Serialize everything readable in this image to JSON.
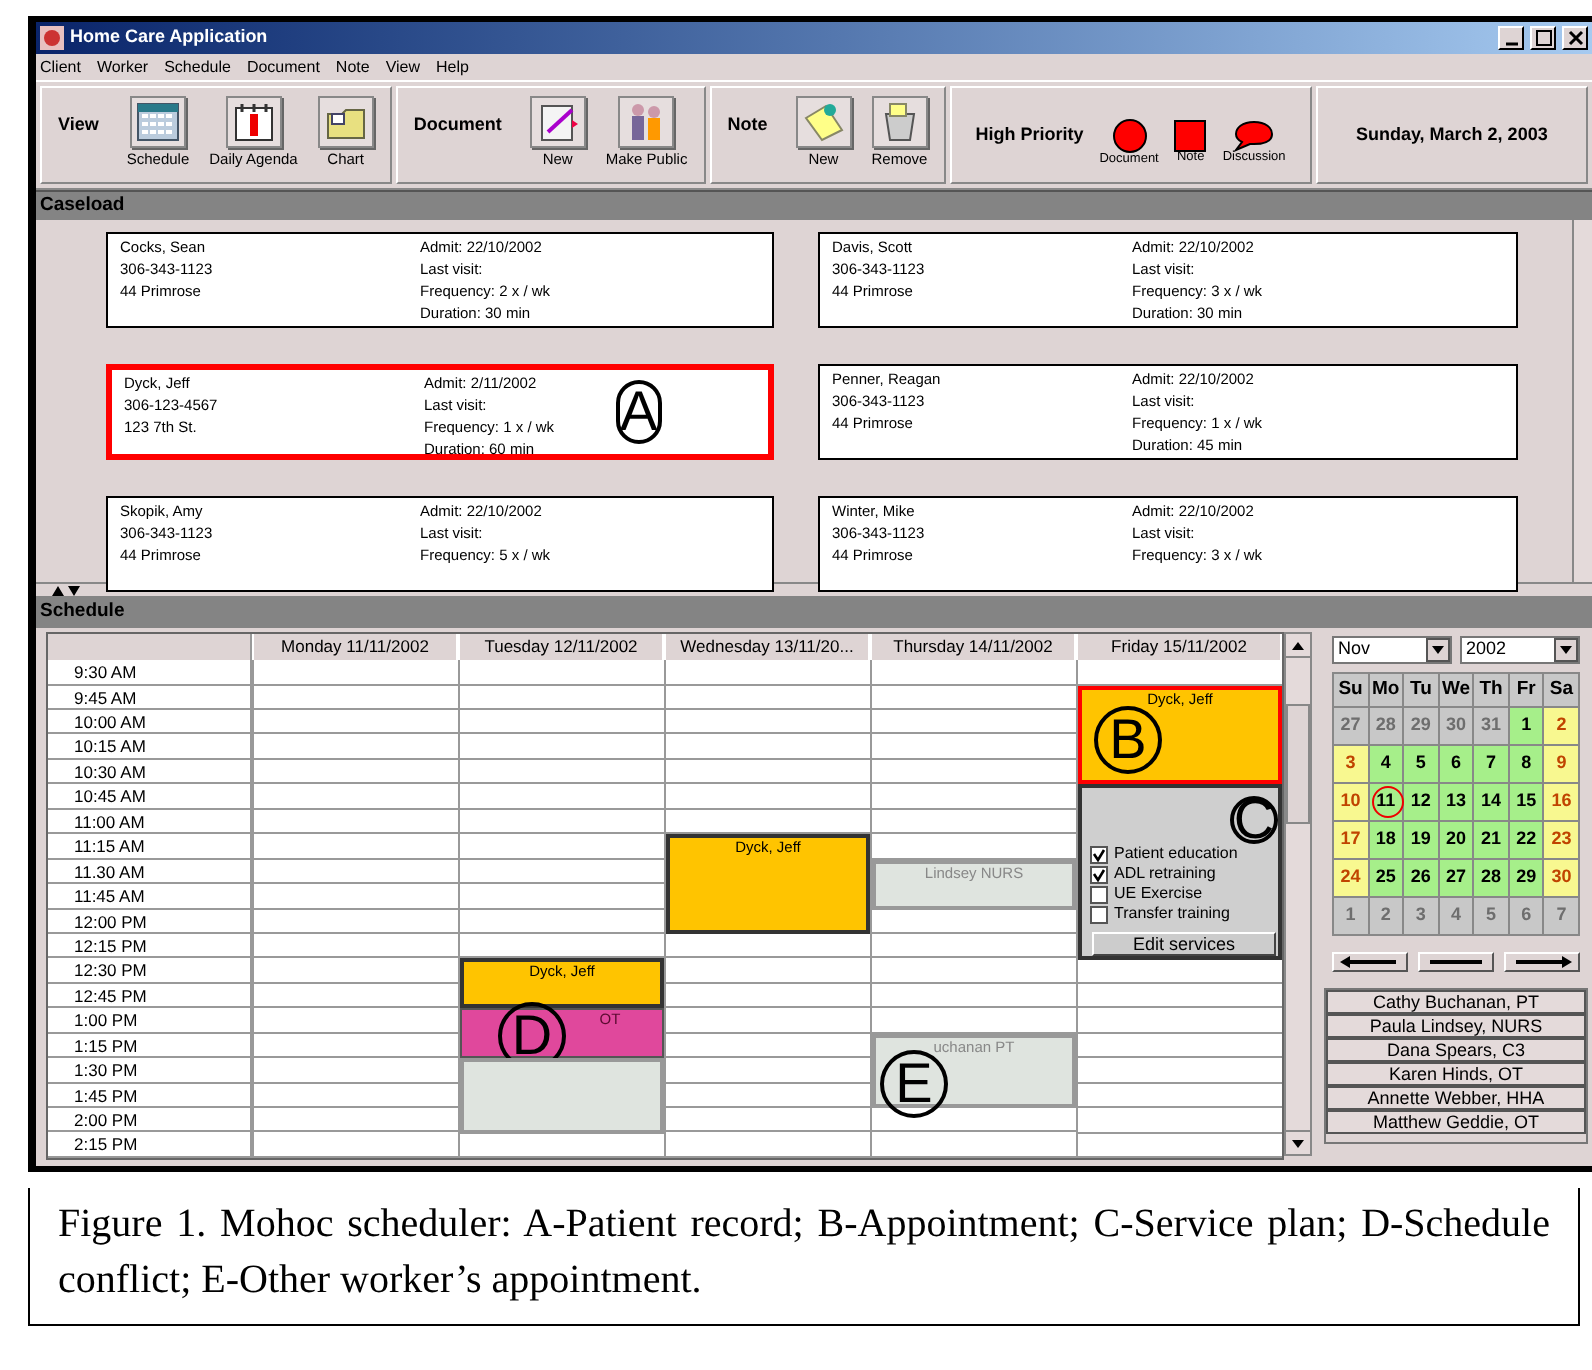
{
  "window": {
    "title": "Home Care Application"
  },
  "menu": [
    "Client",
    "Worker",
    "Schedule",
    "Document",
    "Note",
    "View",
    "Help"
  ],
  "toolbar": [
    {
      "kind": "buttons",
      "label": "View",
      "buttons": [
        {
          "label": "Schedule"
        },
        {
          "label": "Daily Agenda"
        },
        {
          "label": "Chart"
        }
      ]
    },
    {
      "kind": "buttons",
      "label": "Document",
      "buttons": [
        {
          "label": "New"
        },
        {
          "label": "Make Public"
        }
      ]
    },
    {
      "kind": "buttons",
      "label": "Note",
      "buttons": [
        {
          "label": "New"
        },
        {
          "label": "Remove"
        }
      ]
    },
    {
      "kind": "priority",
      "label": "High Priority",
      "items": [
        {
          "label": "Document"
        },
        {
          "label": "Note"
        },
        {
          "label": "Discussion"
        }
      ]
    },
    {
      "kind": "date",
      "label": "Sunday, March 2, 2003"
    }
  ],
  "caseload": {
    "title": "Caseload",
    "cards": [
      {
        "name": "Cocks, Sean",
        "phone": "306-343-1123",
        "address": "44 Primrose",
        "details": [
          "Admit: 22/10/2002",
          "Last visit:",
          "Frequency: 2 x / wk",
          "Duration: 30 min"
        ],
        "selected": false
      },
      {
        "name": "Davis, Scott",
        "phone": "306-343-1123",
        "address": "44 Primrose",
        "details": [
          "Admit: 22/10/2002",
          "Last visit:",
          "Frequency: 3 x / wk",
          "Duration: 30 min"
        ],
        "selected": false
      },
      {
        "name": "Dyck, Jeff",
        "phone": "306-123-4567",
        "address": "123 7th St.",
        "details": [
          "Admit: 2/11/2002",
          "Last visit:",
          "Frequency: 1 x / wk",
          "Duration: 60 min"
        ],
        "selected": true,
        "callout": "A"
      },
      {
        "name": "Penner, Reagan",
        "phone": "306-343-1123",
        "address": "44 Primrose",
        "details": [
          "Admit: 22/10/2002",
          "Last visit:",
          "Frequency: 1 x / wk",
          "Duration: 45 min"
        ],
        "selected": false
      },
      {
        "name": "Skopik, Amy",
        "phone": "306-343-1123",
        "address": "44 Primrose",
        "details": [
          "Admit: 22/10/2002",
          "Last visit:",
          "Frequency: 5 x / wk"
        ],
        "selected": false
      },
      {
        "name": "Winter, Mike",
        "phone": "306-343-1123",
        "address": "44 Primrose",
        "details": [
          "Admit: 22/10/2002",
          "Last visit:",
          "Frequency: 3 x / wk"
        ],
        "selected": false
      }
    ]
  },
  "schedule": {
    "title": "Schedule",
    "times": [
      "9:30 AM",
      "9:45 AM",
      "10:00 AM",
      "10:15 AM",
      "10:30 AM",
      "10:45 AM",
      "11:00 AM",
      "11:15 AM",
      "11.30 AM",
      "11:45 AM",
      "12:00 PM",
      "12:15 PM",
      "12:30 PM",
      "12:45 PM",
      "1:00 PM",
      "1:15 PM",
      "1:30 PM",
      "1:45 PM",
      "2:00 PM",
      "2:15 PM"
    ],
    "days": [
      {
        "label": "Monday 11/11/2002",
        "cells": [
          {
            "kind": "free"
          },
          {
            "kind": "free"
          },
          {
            "kind": "free"
          },
          {
            "kind": "free"
          },
          {
            "kind": "free"
          },
          {
            "kind": "free"
          },
          {
            "kind": "free"
          },
          {
            "kind": "free"
          },
          {
            "kind": "free"
          },
          {
            "kind": "free"
          },
          {
            "kind": "free"
          },
          {
            "kind": "free"
          },
          {
            "kind": "free"
          },
          {
            "kind": "free"
          },
          {
            "kind": "free"
          },
          {
            "kind": "free"
          },
          {
            "kind": "free"
          },
          {
            "kind": "free"
          },
          {
            "kind": "free"
          },
          {
            "kind": "free"
          }
        ]
      },
      {
        "label": "Tuesday 12/11/2002",
        "cells": [
          {
            "kind": "free"
          },
          {
            "kind": "free"
          },
          {
            "kind": "free"
          },
          {
            "kind": "free"
          },
          {
            "kind": "free"
          },
          {
            "kind": "free"
          },
          {
            "kind": "free"
          },
          {
            "kind": "free"
          },
          {
            "kind": "free"
          },
          {
            "kind": "free"
          },
          {
            "kind": "free"
          },
          {
            "kind": "free"
          },
          {
            "kind": "patient",
            "label": "Dyck, Jeff",
            "selected": false
          },
          {
            "kind": "patient"
          },
          {
            "kind": "conflict",
            "label": "OT",
            "callout": "D"
          },
          {
            "kind": "conflict"
          },
          {
            "kind": "other"
          },
          {
            "kind": "other"
          },
          {
            "kind": "other"
          },
          {
            "kind": "free"
          }
        ]
      },
      {
        "label": "Wednesday 13/11/20...",
        "cells": [
          {
            "kind": "free"
          },
          {
            "kind": "free"
          },
          {
            "kind": "free"
          },
          {
            "kind": "free"
          },
          {
            "kind": "free"
          },
          {
            "kind": "free"
          },
          {
            "kind": "free"
          },
          {
            "kind": "patient",
            "label": "Dyck, Jeff",
            "selected": false
          },
          {
            "kind": "patient"
          },
          {
            "kind": "patient"
          },
          {
            "kind": "patient"
          },
          {
            "kind": "free"
          },
          {
            "kind": "free"
          },
          {
            "kind": "free"
          },
          {
            "kind": "free"
          },
          {
            "kind": "free"
          },
          {
            "kind": "free"
          },
          {
            "kind": "free"
          },
          {
            "kind": "free"
          },
          {
            "kind": "free"
          }
        ]
      },
      {
        "label": "Thursday 14/11/2002",
        "cells": [
          {
            "kind": "free"
          },
          {
            "kind": "free"
          },
          {
            "kind": "free"
          },
          {
            "kind": "free"
          },
          {
            "kind": "free"
          },
          {
            "kind": "free"
          },
          {
            "kind": "free"
          },
          {
            "kind": "free"
          },
          {
            "kind": "other",
            "label": "Lindsey NURS"
          },
          {
            "kind": "other"
          },
          {
            "kind": "free"
          },
          {
            "kind": "free"
          },
          {
            "kind": "free"
          },
          {
            "kind": "free"
          },
          {
            "kind": "free"
          },
          {
            "kind": "other",
            "label": "uchanan PT",
            "callout": "E"
          },
          {
            "kind": "other"
          },
          {
            "kind": "other"
          },
          {
            "kind": "free"
          },
          {
            "kind": "free"
          }
        ]
      },
      {
        "label": "Friday 15/11/2002",
        "cells": [
          {
            "kind": "free"
          },
          {
            "kind": "patient",
            "label": "Dyck, Jeff",
            "selected": true,
            "callout": "B"
          },
          {
            "kind": "patient"
          },
          {
            "kind": "patient"
          },
          {
            "kind": "patient"
          },
          {
            "kind": "service",
            "callout": "C",
            "services": [
              {
                "label": "Patient education",
                "checked": true
              },
              {
                "label": "ADL retraining",
                "checked": true
              },
              {
                "label": "UE Exercise",
                "checked": false
              },
              {
                "label": "Transfer training",
                "checked": false
              }
            ],
            "button": "Edit services"
          },
          {
            "kind": "service"
          },
          {
            "kind": "service"
          },
          {
            "kind": "service"
          },
          {
            "kind": "service"
          },
          {
            "kind": "service"
          },
          {
            "kind": "service"
          },
          {
            "kind": "free"
          },
          {
            "kind": "free"
          },
          {
            "kind": "free"
          },
          {
            "kind": "free"
          },
          {
            "kind": "free"
          },
          {
            "kind": "free"
          },
          {
            "kind": "free"
          },
          {
            "kind": "free"
          }
        ]
      }
    ]
  },
  "calendar": {
    "month": "Nov",
    "year": "2002",
    "weekdays": [
      "Su",
      "Mo",
      "Tu",
      "We",
      "Th",
      "Fr",
      "Sa"
    ],
    "weeks": [
      [
        {
          "day": "27",
          "kind": "other",
          "selected": false
        },
        {
          "day": "28",
          "kind": "other",
          "selected": false
        },
        {
          "day": "29",
          "kind": "other",
          "selected": false
        },
        {
          "day": "30",
          "kind": "other",
          "selected": false
        },
        {
          "day": "31",
          "kind": "other",
          "selected": false
        },
        {
          "day": "1",
          "kind": "weekday",
          "selected": false
        },
        {
          "day": "2",
          "kind": "weekend",
          "selected": false
        }
      ],
      [
        {
          "day": "3",
          "kind": "weekend",
          "selected": false
        },
        {
          "day": "4",
          "kind": "weekday",
          "selected": false
        },
        {
          "day": "5",
          "kind": "weekday",
          "selected": false
        },
        {
          "day": "6",
          "kind": "weekday",
          "selected": false
        },
        {
          "day": "7",
          "kind": "weekday",
          "selected": false
        },
        {
          "day": "8",
          "kind": "weekday",
          "selected": false
        },
        {
          "day": "9",
          "kind": "weekend",
          "selected": false
        }
      ],
      [
        {
          "day": "10",
          "kind": "weekend",
          "selected": false
        },
        {
          "day": "11",
          "kind": "weekday",
          "selected": true
        },
        {
          "day": "12",
          "kind": "weekday",
          "selected": false
        },
        {
          "day": "13",
          "kind": "weekday",
          "selected": false
        },
        {
          "day": "14",
          "kind": "weekday",
          "selected": false
        },
        {
          "day": "15",
          "kind": "weekday",
          "selected": false
        },
        {
          "day": "16",
          "kind": "weekend",
          "selected": false
        }
      ],
      [
        {
          "day": "17",
          "kind": "weekend",
          "selected": false
        },
        {
          "day": "18",
          "kind": "weekday",
          "selected": false
        },
        {
          "day": "19",
          "kind": "weekday",
          "selected": false
        },
        {
          "day": "20",
          "kind": "weekday",
          "selected": false
        },
        {
          "day": "21",
          "kind": "weekday",
          "selected": false
        },
        {
          "day": "22",
          "kind": "weekday",
          "selected": false
        },
        {
          "day": "23",
          "kind": "weekend",
          "selected": false
        }
      ],
      [
        {
          "day": "24",
          "kind": "weekend",
          "selected": false
        },
        {
          "day": "25",
          "kind": "weekday",
          "selected": false
        },
        {
          "day": "26",
          "kind": "weekday",
          "selected": false
        },
        {
          "day": "27",
          "kind": "weekday",
          "selected": false
        },
        {
          "day": "28",
          "kind": "weekday",
          "selected": false
        },
        {
          "day": "29",
          "kind": "weekday",
          "selected": false
        },
        {
          "day": "30",
          "kind": "weekend",
          "selected": false
        }
      ],
      [
        {
          "day": "1",
          "kind": "other",
          "selected": false
        },
        {
          "day": "2",
          "kind": "other",
          "selected": false
        },
        {
          "day": "3",
          "kind": "other",
          "selected": false
        },
        {
          "day": "4",
          "kind": "other",
          "selected": false
        },
        {
          "day": "5",
          "kind": "other",
          "selected": false
        },
        {
          "day": "6",
          "kind": "other",
          "selected": false
        },
        {
          "day": "7",
          "kind": "other",
          "selected": false
        }
      ]
    ]
  },
  "workers": [
    "Cathy Buchanan, PT",
    "Paula Lindsey, NURS",
    "Dana Spears, C3",
    "Karen Hinds, OT",
    "Annette Webber, HHA",
    "Matthew Geddie, OT"
  ],
  "caption": "Figure 1. Mohoc scheduler: A-Patient record; B-Appointment; C-Service plan; D-Schedule conflict; E-Other worker’s appointment."
}
